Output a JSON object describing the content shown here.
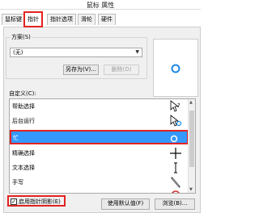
{
  "window": {
    "title": "鼠标 属性"
  },
  "tabs": [
    {
      "label": "鼠标键"
    },
    {
      "label": "指针"
    },
    {
      "label": "指针选项"
    },
    {
      "label": "滑轮"
    },
    {
      "label": "硬件"
    }
  ],
  "scheme": {
    "group_label": "方案(S)",
    "selected": "(无)",
    "save_as_label": "另存为(V)...",
    "delete_label": "删除(D)"
  },
  "customize": {
    "label": "自定义(C):",
    "items": [
      {
        "label": "帮助选择",
        "icon": "help-select-cursor-icon"
      },
      {
        "label": "后台运行",
        "icon": "working-in-background-cursor-icon"
      },
      {
        "label": "忙",
        "icon": "busy-cursor-icon",
        "selected": true
      },
      {
        "label": "精确选择",
        "icon": "precision-select-cursor-icon"
      },
      {
        "label": "文本选择",
        "icon": "text-select-cursor-icon"
      },
      {
        "label": "手写",
        "icon": "handwriting-cursor-icon"
      },
      {
        "label": "",
        "icon": "unavailable-cursor-icon"
      }
    ]
  },
  "shadow": {
    "label": "启用指针阴影(E)",
    "checked": true
  },
  "use_default_label": "使用默认值(F)",
  "browse_label": "浏览(B)...",
  "colors": {
    "selection": "#3399ff",
    "highlight_border": "#e3231f",
    "preview_ring": "#1e88e5"
  }
}
